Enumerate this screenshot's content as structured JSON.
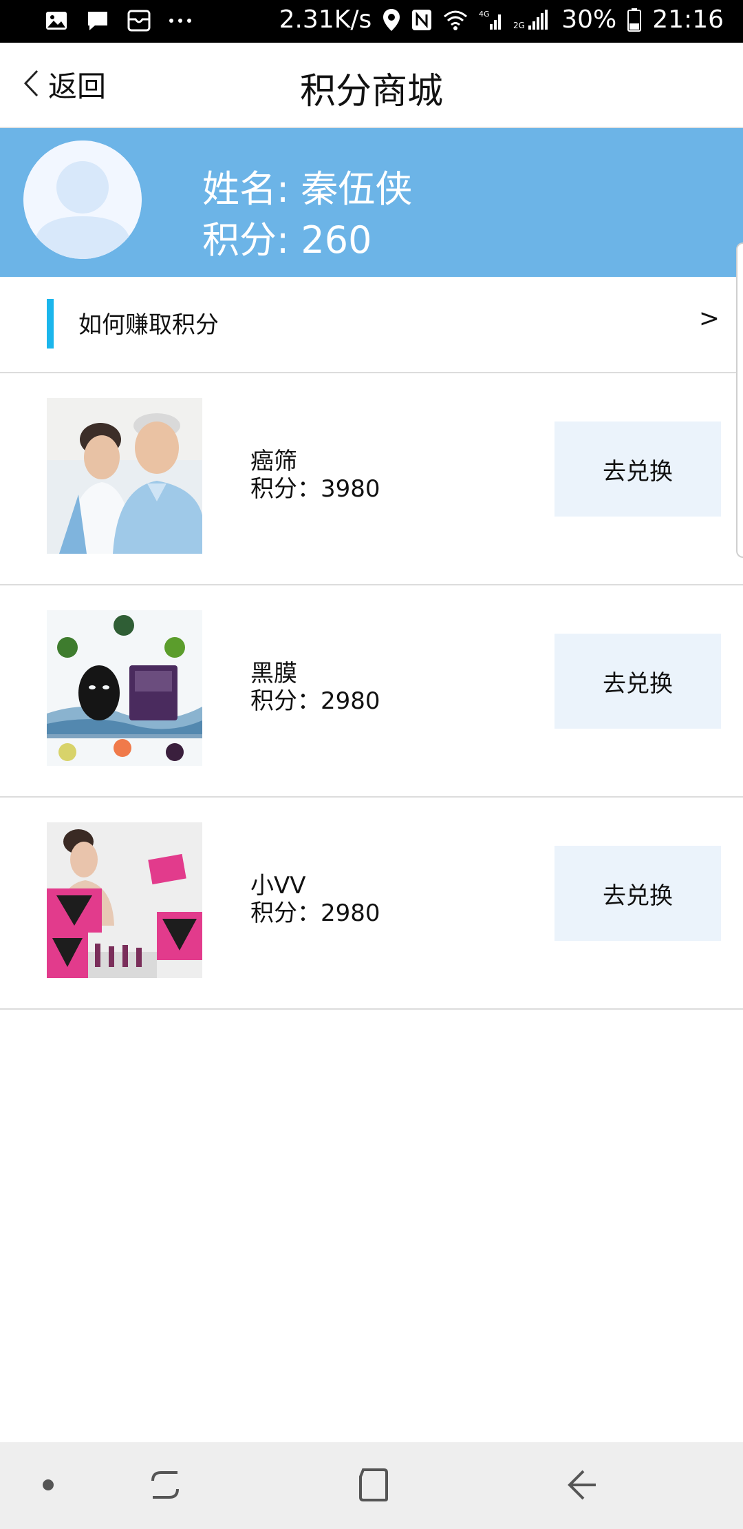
{
  "status_bar": {
    "network_speed": "2.31K/s",
    "battery": "30%",
    "time": "21:16",
    "icons": [
      "image-icon",
      "message-icon",
      "inbox-icon",
      "more-icon",
      "location-icon",
      "nfc-icon",
      "wifi-icon",
      "signal-4g-icon",
      "signal-2g-icon",
      "battery-icon"
    ]
  },
  "header": {
    "back_label": "返回",
    "title": "积分商城"
  },
  "profile": {
    "name_label": "姓名: 秦伍侠",
    "points_label": "积分: 260"
  },
  "earn": {
    "label": "如何赚取积分",
    "arrow": ">"
  },
  "products": [
    {
      "name": "癌筛",
      "points": "积分：3980",
      "button": "去兑换"
    },
    {
      "name": "黑膜",
      "points": "积分：2980",
      "button": "去兑换"
    },
    {
      "name": "小VV",
      "points": "积分：2980",
      "button": "去兑换"
    }
  ],
  "colors": {
    "banner": "#6cb4e7",
    "accent_bar": "#1bb6ec",
    "button_bg": "#ebf3fb"
  }
}
